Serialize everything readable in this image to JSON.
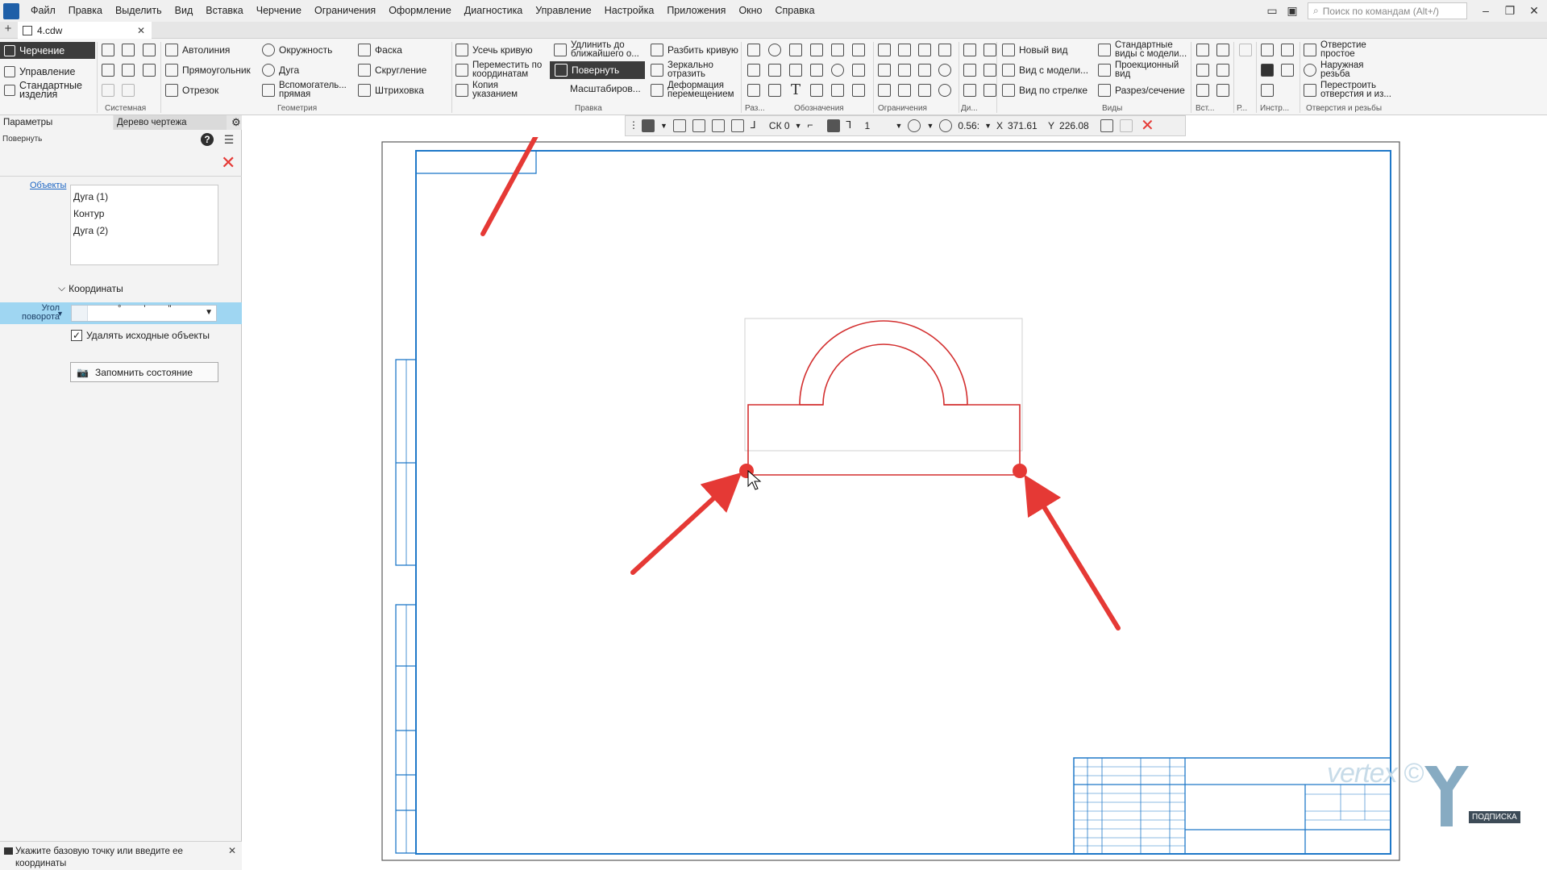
{
  "menu": [
    "Файл",
    "Правка",
    "Выделить",
    "Вид",
    "Вставка",
    "Черчение",
    "Ограничения",
    "Оформление",
    "Диагностика",
    "Управление",
    "Настройка",
    "Приложения",
    "Окно",
    "Справка"
  ],
  "search_placeholder": "Поиск по командам (Alt+/)",
  "doc_tab": "4.cdw",
  "modes": [
    "Черчение",
    "Управление",
    "Стандартные изделия"
  ],
  "ribbon": {
    "geometry": {
      "avtoliniya": "Автолиния",
      "pryamougolnik": "Прямоугольник",
      "otrezok": "Отрезок",
      "okruzhnost": "Окружность",
      "duga": "Дуга",
      "vspomogatelnaya": "Вспомогатель... прямая",
      "faska": "Фаска",
      "skruglenie": "Скругление",
      "shtrikhovka": "Штриховка"
    },
    "edit": {
      "usech": "Усечь кривую",
      "peremestit": "Переместить по координатам",
      "kopiya": "Копия указанием",
      "udlinit": "Удлинить до ближайшего о...",
      "povernut": "Повернуть",
      "masshtab": "Масштабиров...",
      "razbit": "Разбить кривую",
      "zerkalno": "Зеркально отразить",
      "deformaciya": "Деформация перемещением"
    },
    "views": {
      "novyi_vid": "Новый вид",
      "vid_s_modeli": "Вид с модели...",
      "vid_po_strelke": "Вид по стрелке",
      "standartnye_vidy": "Стандартные виды с модели...",
      "proekcionnyi": "Проекционный вид",
      "razrez": "Разрез/сечение"
    },
    "holes": {
      "otverstie": "Отверстие простое",
      "rezba": "Наружная резьба",
      "perestroit": "Перестроить отверстия и из..."
    },
    "group_labels": {
      "sistemnaya": "Системная",
      "geometriya": "Геометрия",
      "pravka": "Правка",
      "raz": "Раз...",
      "oboznacheniya": "Обозначения",
      "ogranicheniya": "Ограничения",
      "di": "Ди...",
      "vidy": "Виды",
      "vst": "Вст...",
      "r": "Р...",
      "instr": "Инстр...",
      "otverstiya": "Отверстия и резьбы"
    }
  },
  "floatbar": {
    "ck": "СК 0",
    "layer": "1",
    "zoom": "0.56:",
    "x_label": "X",
    "x_value": "371.61",
    "y_label": "Y",
    "y_value": "226.08"
  },
  "panel": {
    "tab_params": "Параметры",
    "tab_tree": "Дерево чертежа",
    "command": "Повернуть",
    "objects_label": "Объекты",
    "objects": [
      "Дуга (1)",
      "Контур",
      "Дуга (2)"
    ],
    "coords_header": "Координаты",
    "angle_label": "Угол поворота",
    "delete_src": "Удалять исходные объекты",
    "remember": "Запомнить состояние",
    "status": "Укажите базовую точку или введите ее координаты"
  },
  "watermark": {
    "brand": "vertex ©",
    "sub": "ПОДПИСКА"
  },
  "colors": {
    "accent_red": "#e53935",
    "frame_blue": "#1f78c8",
    "shape_red": "#d32f2f"
  }
}
